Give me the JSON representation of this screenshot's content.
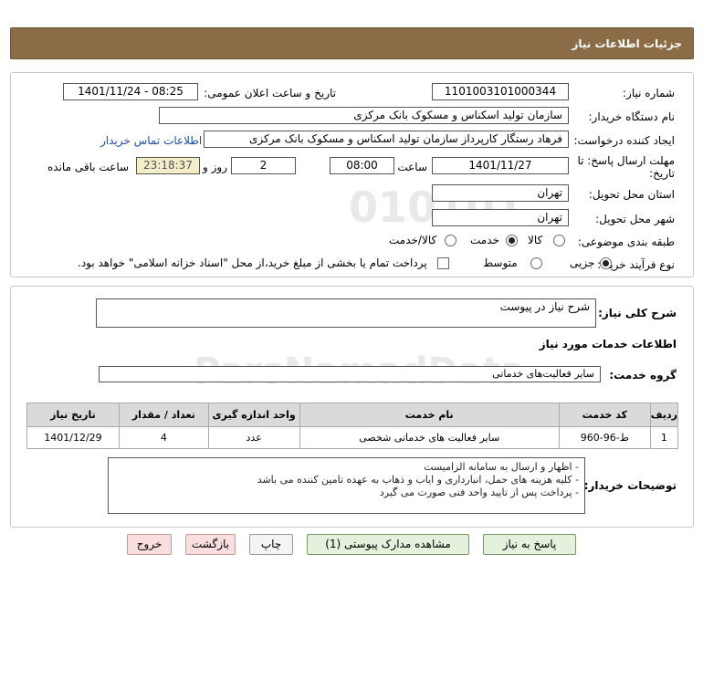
{
  "header": {
    "title": "جزئیات اطلاعات نیاز"
  },
  "form": {
    "need_number_label": "شماره نیاز:",
    "need_number": "1101003101000344",
    "announce_label": "تاریخ و ساعت اعلان عمومی:",
    "announce_value": "1401/11/24 - 08:25",
    "buyer_org_label": "نام دستگاه خریدار:",
    "buyer_org": "سازمان تولید اسکناس و مسکوک بانک مرکزی",
    "creator_label": "ایجاد کننده درخواست:",
    "creator": "فرهاد رستگار کارپرداز سازمان تولید اسکناس و مسکوک بانک مرکزی",
    "contact_link": "اطلاعات تماس خریدار",
    "deadline_label_1": "مهلت ارسال پاسخ: تا",
    "deadline_label_2": "تاریخ:",
    "deadline_date": "1401/11/27",
    "time_label": "ساعت",
    "deadline_time": "08:00",
    "days_value": "2",
    "days_label": "روز و",
    "remaining_time": "23:18:37",
    "remaining_label": "ساعت باقی مانده",
    "province_label": "استان محل تحویل:",
    "province": "تهران",
    "city_label": "شهر محل تحویل:",
    "city": "تهران",
    "category_label": "طبقه بندی موضوعی:",
    "category_options": [
      "کالا",
      "خدمت",
      "کالا/خدمت"
    ],
    "category_selected": "خدمت",
    "purchase_type_label": "نوع فرآیند خرید :",
    "purchase_options": [
      "جزیی",
      "متوسط"
    ],
    "purchase_selected": "جزیی",
    "treasury_note": "پرداخت تمام یا بخشی از مبلغ خرید،از محل \"اسناد خزانه اسلامی\" خواهد بود."
  },
  "details": {
    "general_desc_label": "شرح کلی نیاز:",
    "general_desc": "شرح نیاز در پیوست",
    "services_info_title": "اطلاعات خدمات مورد نیاز",
    "service_group_label": "گروه خدمت:",
    "service_group": "سایر فعالیت‌های خدماتی",
    "table": {
      "headers": [
        "ردیف",
        "کد خدمت",
        "نام خدمت",
        "واحد اندازه گیری",
        "تعداد / مقدار",
        "تاریخ نیاز"
      ],
      "rows": [
        [
          "1",
          "ط-96-960",
          "سایر فعالیت های خدماتی شخصی",
          "عدد",
          "4",
          "1401/12/29"
        ]
      ]
    },
    "buyer_notes_label": "توضیحات خریدار:",
    "buyer_notes": [
      "- اظهار و ارسال به سامانه الزامیست",
      "- کلیه هزینه های حمل، انبارداری و ایاب و ذهاب به عهده تامین کننده می باشد",
      "- پرداخت پس از تایید واحد فنی صورت می گیرد"
    ]
  },
  "buttons": {
    "reply": "پاسخ به نیاز",
    "attachments": "مشاهده مدارک پیوستی (1)",
    "print": "چاپ",
    "back": "بازگشت",
    "exit": "خروج"
  },
  "watermark": {
    "brand": "ParsNamadData"
  }
}
